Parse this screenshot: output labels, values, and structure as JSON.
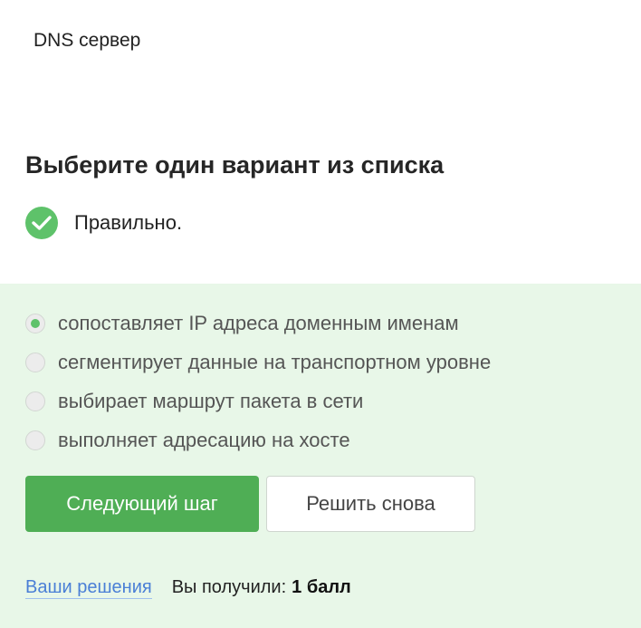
{
  "step": {
    "text": "DNS сервер"
  },
  "task": {
    "title": "Выберите один вариант из списка"
  },
  "feedback": {
    "icon": "check-circle-icon",
    "text": "Правильно.",
    "color": "#5ec26a"
  },
  "answer_panel": {
    "background": "#e8f7e8",
    "options": [
      {
        "label": "сопоставляет IP адреса доменным именам",
        "selected": true
      },
      {
        "label": "сегментирует данные на транспортном уровне",
        "selected": false
      },
      {
        "label": "выбирает маршрут пакета в сети",
        "selected": false
      },
      {
        "label": "выполняет адресацию на хосте",
        "selected": false
      }
    ]
  },
  "buttons": {
    "next_label": "Следующий шаг",
    "retry_label": "Решить снова",
    "next_color": "#4fae55"
  },
  "footer": {
    "solutions_link": "Ваши решения",
    "score_prefix": "Вы получили:",
    "score_value": "1 балл"
  }
}
